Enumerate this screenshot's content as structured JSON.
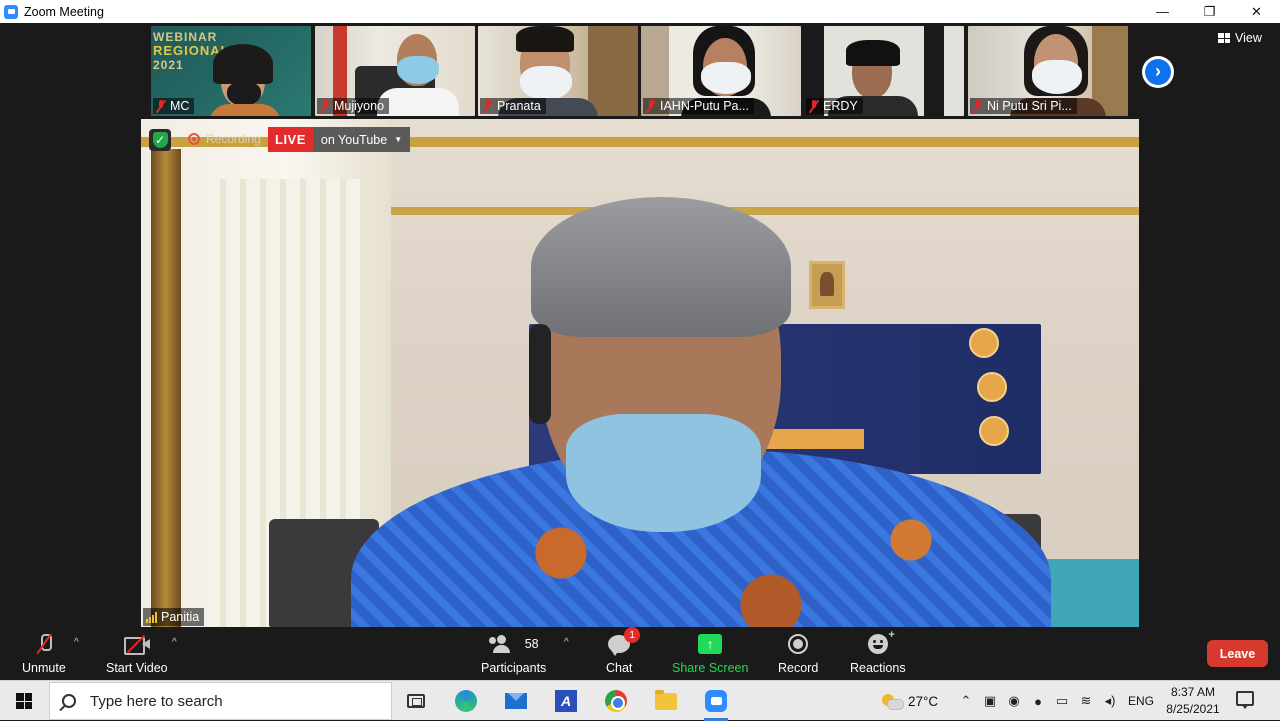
{
  "window": {
    "title": "Zoom Meeting",
    "minimize_glyph": "—",
    "restore_glyph": "❐",
    "close_glyph": "✕"
  },
  "gallery": {
    "view_label": "View",
    "next_glyph": "›",
    "participants": [
      {
        "name": "MC",
        "muted": true
      },
      {
        "name": "Mujiyono",
        "muted": true
      },
      {
        "name": "Pranata",
        "muted": true
      },
      {
        "name": "IAHN-Putu Pa...",
        "muted": true
      },
      {
        "name": "ERDY",
        "muted": true
      },
      {
        "name": "Ni Putu Sri Pi...",
        "muted": true
      }
    ],
    "webinar_text": {
      "line1": "WEBINAR",
      "line2": "REGIONAL",
      "line3": "2021"
    }
  },
  "main_video": {
    "speaker_name": "Panitia",
    "recording_label": "Recording",
    "live_label": "LIVE",
    "live_destination": "on YouTube",
    "caret": "▼"
  },
  "toolbar": {
    "unmute_label": "Unmute",
    "start_video_label": "Start Video",
    "participants_label": "Participants",
    "participants_count": "58",
    "chat_label": "Chat",
    "chat_badge": "1",
    "share_label": "Share Screen",
    "record_label": "Record",
    "reactions_label": "Reactions",
    "leave_label": "Leave",
    "caret_up": "^",
    "accent_share": "#23d959",
    "accent_leave": "#d63a2f"
  },
  "taskbar": {
    "search_placeholder": "Type here to search",
    "temperature": "27°C",
    "language": "ENG",
    "time": "8:37 AM",
    "date": "8/25/2021",
    "tray_caret": "⌃",
    "apps": [
      "task-view-icon",
      "edge-icon",
      "mail-icon",
      "editor-icon",
      "chrome-icon",
      "file-explorer-icon",
      "zoom-icon"
    ]
  }
}
